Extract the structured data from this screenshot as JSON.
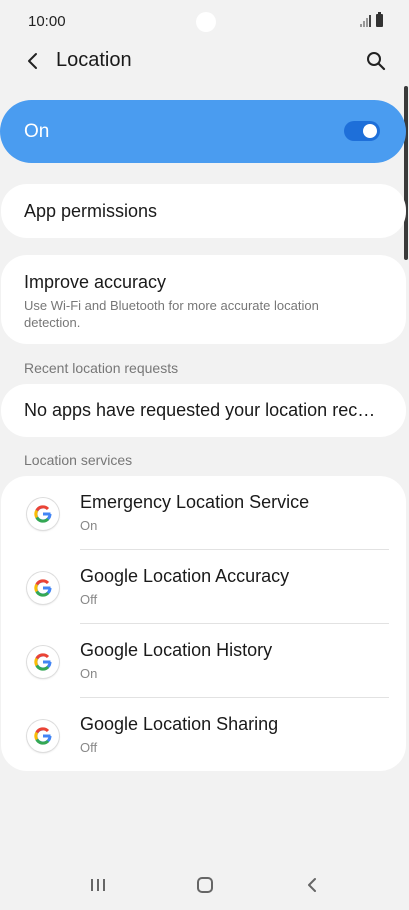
{
  "status_bar": {
    "time": "10:00"
  },
  "header": {
    "title": "Location",
    "back_icon": "chevron-left-icon",
    "search_icon": "search-icon"
  },
  "master_toggle": {
    "label": "On",
    "state": "on",
    "color": "#4a9cf0"
  },
  "app_permissions": {
    "label": "App permissions"
  },
  "improve_accuracy": {
    "label": "Improve accuracy",
    "description": "Use Wi-Fi and Bluetooth for more accurate location detection."
  },
  "recent_requests": {
    "header": "Recent location requests",
    "message": "No apps have requested your location recently"
  },
  "location_services": {
    "header": "Location services",
    "items": [
      {
        "title": "Emergency Location Service",
        "status": "On"
      },
      {
        "title": "Google Location Accuracy",
        "status": "Off"
      },
      {
        "title": "Google Location History",
        "status": "On"
      },
      {
        "title": "Google Location Sharing",
        "status": "Off"
      }
    ]
  },
  "nav_bar": {
    "recents_icon": "recents-icon",
    "home_icon": "home-icon",
    "back_icon": "back-icon"
  }
}
